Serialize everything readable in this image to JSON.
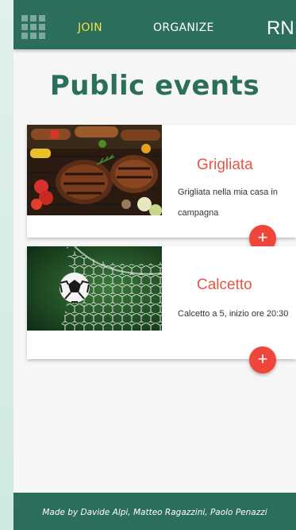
{
  "navbar": {
    "join_label": "JOIN",
    "organize_label": "ORGANIZE",
    "brand": "RN"
  },
  "page": {
    "title": "Public events"
  },
  "events": [
    {
      "title": "Grigliata",
      "description": "Grigliata nella mia casa in campagna",
      "add_label": "+"
    },
    {
      "title": "Calcetto",
      "description": "Calcetto a 5, inizio ore 20:30",
      "add_label": "+"
    }
  ],
  "footer": {
    "credits": "Made by Davide Alpi, Matteo Ragazzini, Paolo Penazzi"
  },
  "colors": {
    "primary": "#2c6e5c",
    "accent": "#f0453a",
    "nav_active": "#f3e34b",
    "card_title": "#e85544"
  }
}
